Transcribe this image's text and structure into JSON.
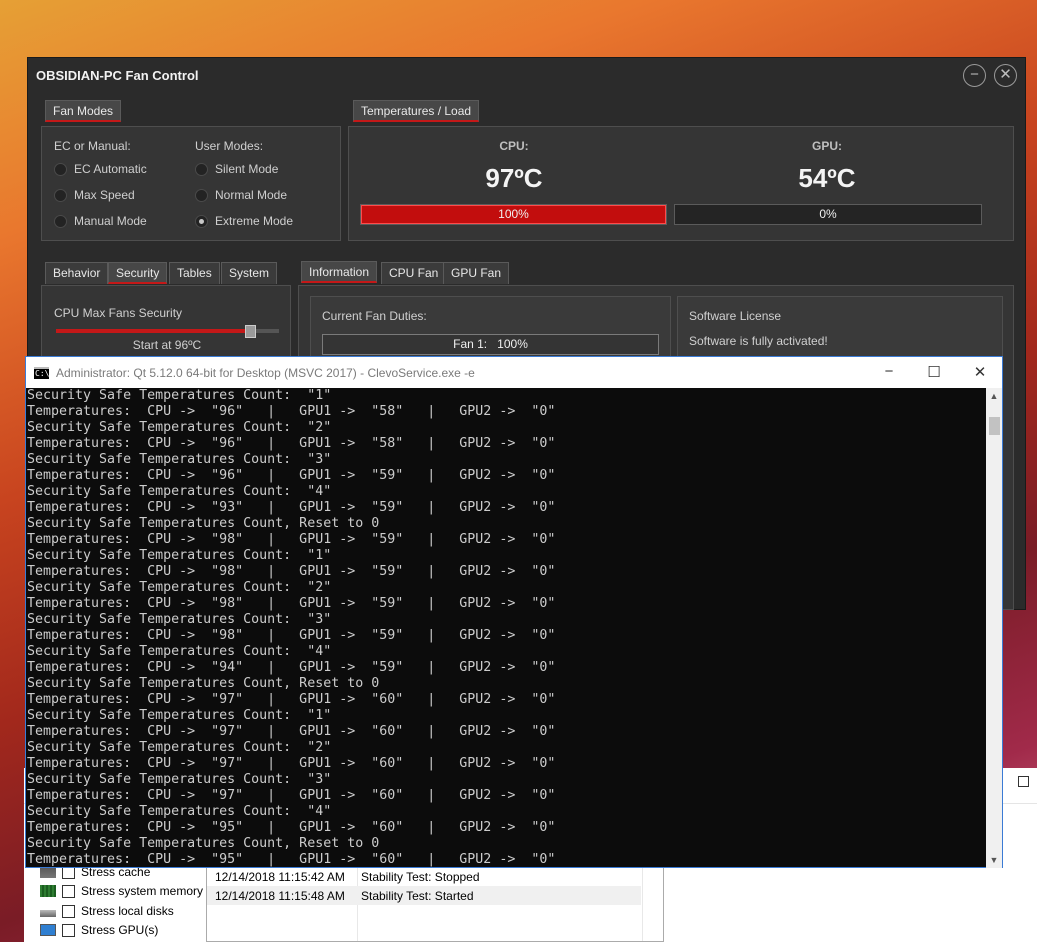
{
  "stress_window": {
    "options": [
      {
        "label": "Stress cache",
        "icon": "cache-chip-icon"
      },
      {
        "label": "Stress system memory",
        "icon": "memory-icon"
      },
      {
        "label": "Stress local disks",
        "icon": "disk-icon"
      },
      {
        "label": "Stress GPU(s)",
        "icon": "monitor-icon"
      }
    ],
    "log": [
      {
        "time": "12/14/2018 11:15:42 AM",
        "event": "Stability Test: Stopped"
      },
      {
        "time": "12/14/2018 11:15:48 AM",
        "event": "Stability Test: Started"
      }
    ]
  },
  "fan_window": {
    "title": "OBSIDIAN-PC Fan Control",
    "fan_modes_tab": "Fan Modes",
    "temps_tab": "Temperatures / Load",
    "ec_header": "EC or Manual:",
    "user_header": "User Modes:",
    "ec_modes": [
      "EC Automatic",
      "Max Speed",
      "Manual Mode"
    ],
    "user_modes": [
      "Silent Mode",
      "Normal Mode",
      "Extreme Mode"
    ],
    "selected_user_mode": "Extreme Mode",
    "cpu": {
      "label": "CPU:",
      "temp": "97ºC",
      "load_label": "100%",
      "load": 1.0
    },
    "gpu": {
      "label": "GPU:",
      "temp": "54ºC",
      "load_label": "0%",
      "load": 0.0
    },
    "left_tabs": [
      "Behavior",
      "Security",
      "Tables",
      "System"
    ],
    "active_left_tab": "Security",
    "right_tabs": [
      "Information",
      "CPU Fan",
      "GPU Fan"
    ],
    "active_right_tab": "Information",
    "security": {
      "title": "CPU Max Fans Security",
      "start_label": "Start at 96ºC",
      "slider_fraction": 0.87
    },
    "duties": {
      "title": "Current Fan Duties:",
      "fan1_label": "Fan 1:",
      "fan1_value": "100%"
    },
    "license": {
      "title": "Software License",
      "status": "Software is fully activated!"
    }
  },
  "console": {
    "title": "Administrator: Qt 5.12.0 64-bit for Desktop (MSVC 2017) - ClevoService.exe  -e",
    "lines": [
      "Security Safe Temperatures Count:  \"1\"",
      "Temperatures:  CPU ->  \"96\"   |   GPU1 ->  \"58\"   |   GPU2 ->  \"0\"",
      "Security Safe Temperatures Count:  \"2\"",
      "Temperatures:  CPU ->  \"96\"   |   GPU1 ->  \"58\"   |   GPU2 ->  \"0\"",
      "Security Safe Temperatures Count:  \"3\"",
      "Temperatures:  CPU ->  \"96\"   |   GPU1 ->  \"59\"   |   GPU2 ->  \"0\"",
      "Security Safe Temperatures Count:  \"4\"",
      "Temperatures:  CPU ->  \"93\"   |   GPU1 ->  \"59\"   |   GPU2 ->  \"0\"",
      "Security Safe Temperatures Count, Reset to 0",
      "Temperatures:  CPU ->  \"98\"   |   GPU1 ->  \"59\"   |   GPU2 ->  \"0\"",
      "Security Safe Temperatures Count:  \"1\"",
      "Temperatures:  CPU ->  \"98\"   |   GPU1 ->  \"59\"   |   GPU2 ->  \"0\"",
      "Security Safe Temperatures Count:  \"2\"",
      "Temperatures:  CPU ->  \"98\"   |   GPU1 ->  \"59\"   |   GPU2 ->  \"0\"",
      "Security Safe Temperatures Count:  \"3\"",
      "Temperatures:  CPU ->  \"98\"   |   GPU1 ->  \"59\"   |   GPU2 ->  \"0\"",
      "Security Safe Temperatures Count:  \"4\"",
      "Temperatures:  CPU ->  \"94\"   |   GPU1 ->  \"59\"   |   GPU2 ->  \"0\"",
      "Security Safe Temperatures Count, Reset to 0",
      "Temperatures:  CPU ->  \"97\"   |   GPU1 ->  \"60\"   |   GPU2 ->  \"0\"",
      "Security Safe Temperatures Count:  \"1\"",
      "Temperatures:  CPU ->  \"97\"   |   GPU1 ->  \"60\"   |   GPU2 ->  \"0\"",
      "Security Safe Temperatures Count:  \"2\"",
      "Temperatures:  CPU ->  \"97\"   |   GPU1 ->  \"60\"   |   GPU2 ->  \"0\"",
      "Security Safe Temperatures Count:  \"3\"",
      "Temperatures:  CPU ->  \"97\"   |   GPU1 ->  \"60\"   |   GPU2 ->  \"0\"",
      "Security Safe Temperatures Count:  \"4\"",
      "Temperatures:  CPU ->  \"95\"   |   GPU1 ->  \"60\"   |   GPU2 ->  \"0\"",
      "Security Safe Temperatures Count, Reset to 0",
      "Temperatures:  CPU ->  \"95\"   |   GPU1 ->  \"60\"   |   GPU2 ->  \"0\""
    ]
  }
}
